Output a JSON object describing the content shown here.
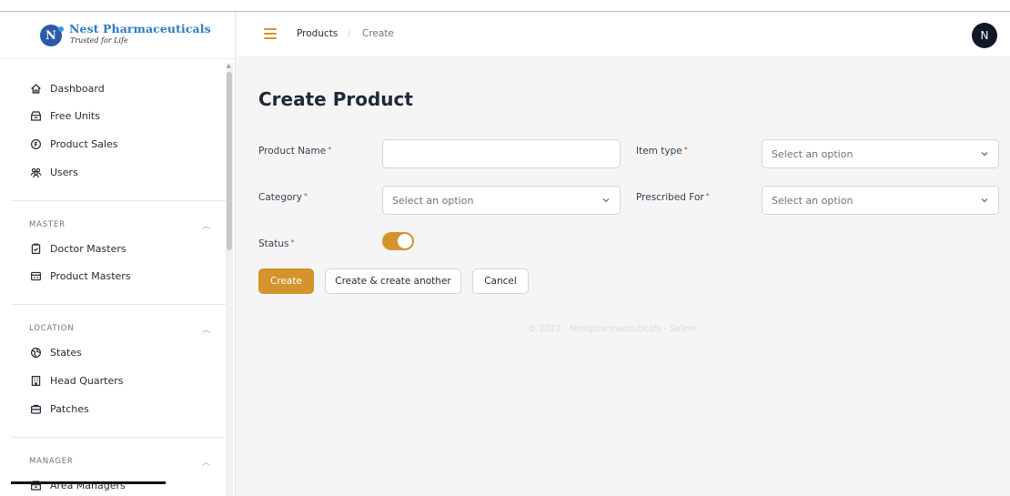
{
  "brand": {
    "logo_letter": "N",
    "name": "Nest Pharmaceuticals",
    "tagline": "Trusted for Life"
  },
  "sidebar": {
    "items": [
      {
        "label": "Dashboard",
        "icon": "home-icon"
      },
      {
        "label": "Free Units",
        "icon": "box-icon"
      },
      {
        "label": "Product Sales",
        "icon": "coin-icon"
      },
      {
        "label": "Users",
        "icon": "users-icon"
      }
    ],
    "groups": [
      {
        "label": "MASTER",
        "items": [
          {
            "label": "Doctor Masters",
            "icon": "clipboard-check-icon"
          },
          {
            "label": "Product Masters",
            "icon": "product-card-icon"
          }
        ]
      },
      {
        "label": "LOCATION",
        "items": [
          {
            "label": "States",
            "icon": "globe-icon"
          },
          {
            "label": "Head Quarters",
            "icon": "building-icon"
          },
          {
            "label": "Patches",
            "icon": "briefcase-icon"
          }
        ]
      },
      {
        "label": "MANAGER",
        "items": [
          {
            "label": "Area Managers",
            "icon": "box-icon"
          }
        ]
      }
    ]
  },
  "header": {
    "breadcrumb": [
      "Products",
      "Create"
    ],
    "breadcrumb_separator": "/",
    "avatar_initial": "N"
  },
  "form": {
    "title": "Create Product",
    "required_mark": "*",
    "fields": {
      "product_name": {
        "label": "Product Name",
        "value": ""
      },
      "item_type": {
        "label": "Item type",
        "value": "Select an option"
      },
      "category": {
        "label": "Category",
        "value": "Select an option"
      },
      "prescribed_for": {
        "label": "Prescribed For",
        "value": "Select an option"
      },
      "status": {
        "label": "Status",
        "enabled": true
      }
    },
    "buttons": {
      "create": "Create",
      "create_another": "Create & create another",
      "cancel": "Cancel"
    }
  },
  "footer": "© 2022 - Nestpharmaceuticals - Salem",
  "colors": {
    "accent": "#d4932c",
    "brand_blue": "#2b7bc4",
    "avatar": "#111827"
  }
}
